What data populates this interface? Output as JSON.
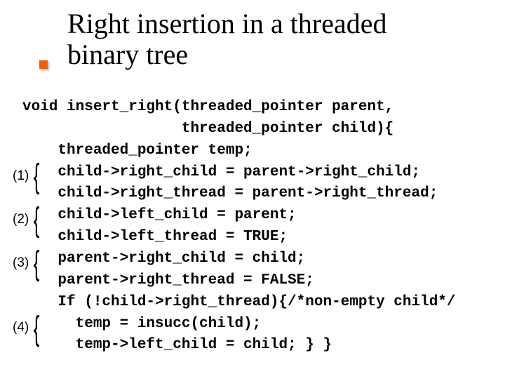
{
  "title_line1": "Right insertion in a threaded",
  "title_line2": "binary tree",
  "code": {
    "l1": "void insert_right(threaded_pointer parent,",
    "l2": "                  threaded_pointer child){",
    "l3": "    threaded_pointer temp;",
    "l4": "    child->right_child = parent->right_child;",
    "l5": "    child->right_thread = parent->right_thread;",
    "l6": "    child->left_child = parent;",
    "l7": "    child->left_thread = TRUE;",
    "l8": "    parent->right_child = child;",
    "l9": "    parent->right_thread = FALSE;",
    "l10": "    If (!child->right_thread){/*non-empty child*/",
    "l11": "      temp = insucc(child);",
    "l12": "      temp->left_child = child; } }"
  },
  "annotations": {
    "a1": "(1)",
    "a2": "(2)",
    "a3": "(3)",
    "a4": "(4)"
  }
}
